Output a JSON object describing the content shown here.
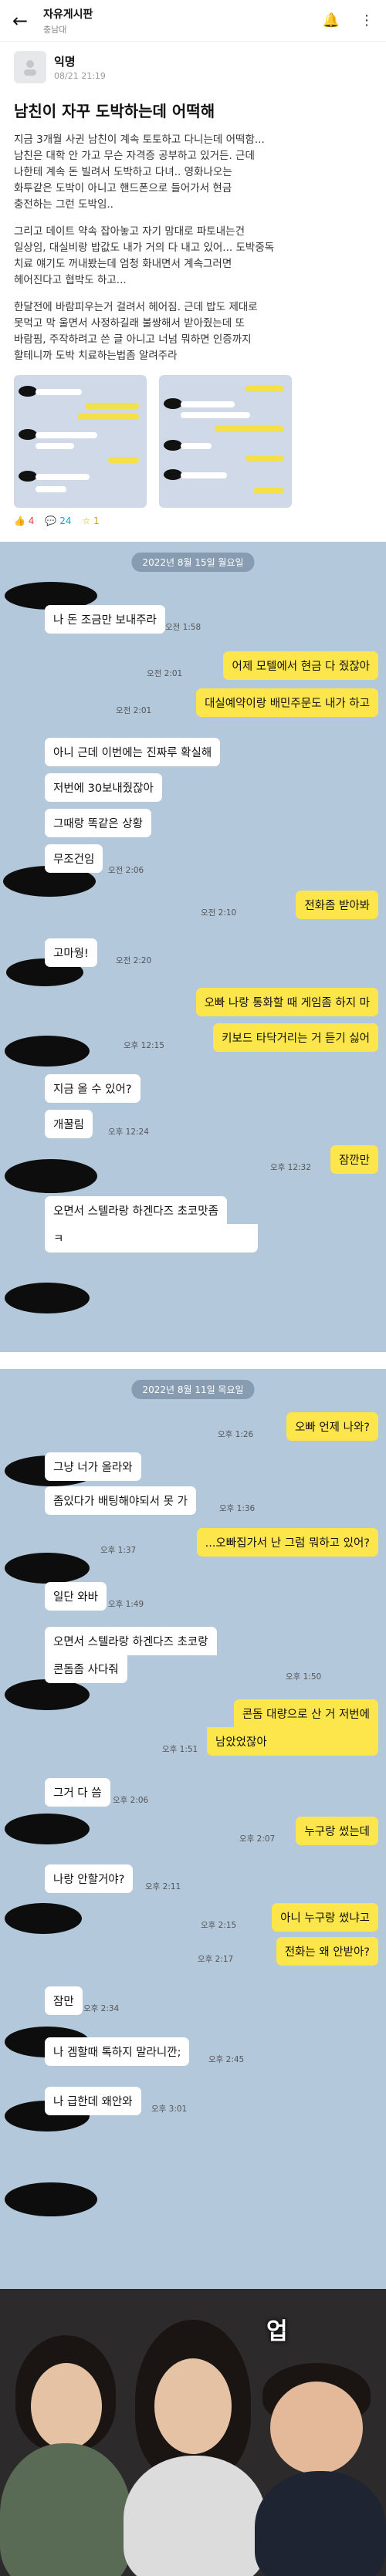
{
  "header": {
    "board": "자유게시판",
    "region": "충남대"
  },
  "post": {
    "author": "익명",
    "date": "08/21 21:19",
    "title": "남친이 자꾸 도박하는데 어떡해",
    "paragraphs": [
      "지금 3개월 사귄 남친이 계속 토토하고 다니는데 어떡함...\n남친은 대학 안 가고 무슨 자격증 공부하고 있거든. 근데\n나한테 계속 돈 빌려서 도박하고 다녀.. 영화나오는\n화투같은 도박이 아니고 핸드폰으로 들어가서 현금\n충전하는 그런 도박임..",
      "그리고 데이트 약속 잡아놓고 자기 맘대로 파토내는건\n일상임, 대실비랑 밥값도 내가 거의 다 내고 있어... 도박중독\n치료 얘기도 꺼내봤는데 엄청 화내면서 계속그러면\n헤어진다고 협박도 하고...",
      "한달전에 바람피우는거 걸려서 헤어짐. 근데 밥도 제대로\n못먹고 막 울면서 사정하길래 불쌍해서 받아줬는데 또\n바람핌, 주작하려고 쓴 글 아니고 너넘 뭐하면 인증까지\n할테니까 도박 치료하는법좀 알려주라"
    ],
    "likes": "4",
    "comments": "24",
    "scraps": "1"
  },
  "chat1": {
    "date": "2022년 8월 15일 월요일",
    "messages": [
      {
        "side": "l",
        "text": "나 돈 조금만 보내주라"
      },
      {
        "side": "t",
        "text": "오전 1:58"
      },
      {
        "side": "r",
        "text": "어제 모텔에서 현금 다 줬잖아"
      },
      {
        "side": "t",
        "text": "오전 2:01"
      },
      {
        "side": "r",
        "text": "대실예약이랑 배민주문도 내가 하고"
      },
      {
        "side": "t",
        "text": "오전 2:01"
      },
      {
        "side": "l",
        "text": "아니 근데 이번에는 진짜루 확실해"
      },
      {
        "side": "l",
        "text": "저번에 30보내줬잖아"
      },
      {
        "side": "l",
        "text": "그때랑 똑같은 상황"
      },
      {
        "side": "l",
        "text": "무조건임"
      },
      {
        "side": "t",
        "text": "오전 2:06"
      },
      {
        "side": "r",
        "text": "전화좀 받아봐"
      },
      {
        "side": "t",
        "text": "오전 2:10"
      },
      {
        "side": "l",
        "text": "고마웡!"
      },
      {
        "side": "t",
        "text": "오전 2:20"
      },
      {
        "side": "r",
        "text": "오빠 나랑 통화할 때 게임좀 하지 마"
      },
      {
        "side": "r",
        "text": "키보드 타닥거리는 거 듣기 싫어"
      },
      {
        "side": "t",
        "text": "오후 12:15"
      },
      {
        "side": "l",
        "text": "지금 올 수 있어?"
      },
      {
        "side": "l",
        "text": "개꿀림"
      },
      {
        "side": "t",
        "text": "오후 12:24"
      },
      {
        "side": "r",
        "text": "잠깐만"
      },
      {
        "side": "t",
        "text": "오후 12:32"
      },
      {
        "side": "l",
        "text": "오면서 스텔라랑 하겐다즈 초코맛좀"
      },
      {
        "side": "l",
        "text": "ㅋ"
      }
    ]
  },
  "chat2": {
    "date": "2022년 8월 11일 목요일",
    "messages": [
      {
        "side": "r",
        "text": "오빠 언제 나와?"
      },
      {
        "side": "t",
        "text": "오후 1:26"
      },
      {
        "side": "l",
        "text": "그냥 너가 올라와"
      },
      {
        "side": "l",
        "text": "좀있다가 배팅해야되서 못 가"
      },
      {
        "side": "t",
        "text": "오후 1:36"
      },
      {
        "side": "r",
        "text": "...오빠집가서 난 그럼 뭐하고 있어?"
      },
      {
        "side": "t",
        "text": "오후 1:37"
      },
      {
        "side": "l",
        "text": "일단 와바"
      },
      {
        "side": "t",
        "text": "오후 1:49"
      },
      {
        "side": "l",
        "text": "오면서 스텔라랑 하겐다즈 초코랑"
      },
      {
        "side": "l",
        "text": "콘돔좀 사다줘"
      },
      {
        "side": "t",
        "text": "오후 1:50"
      },
      {
        "side": "r",
        "text": "콘돔 대량으로 산 거 저번에"
      },
      {
        "side": "r",
        "text": "남았었잖아"
      },
      {
        "side": "t",
        "text": "오후 1:51"
      },
      {
        "side": "l",
        "text": "그거 다 씀"
      },
      {
        "side": "t",
        "text": "오후 2:06"
      },
      {
        "side": "r",
        "text": "누구랑 썼는데"
      },
      {
        "side": "t",
        "text": "오후 2:07"
      },
      {
        "side": "l",
        "text": "나랑 안할거야?"
      },
      {
        "side": "t",
        "text": "오후 2:11"
      },
      {
        "side": "r",
        "text": "아니 누구랑 썼냐고"
      },
      {
        "side": "t",
        "text": "오후 2:15"
      },
      {
        "side": "r",
        "text": "전화는 왜 안받아?"
      },
      {
        "side": "t",
        "text": "오후 2:17"
      },
      {
        "side": "l",
        "text": "잠만"
      },
      {
        "side": "t",
        "text": "오후 2:34"
      },
      {
        "side": "l",
        "text": "나 겜할때 톡하지 말라니깐;"
      },
      {
        "side": "t",
        "text": "오후 2:45"
      },
      {
        "side": "l",
        "text": "나 급한데 왜안와"
      },
      {
        "side": "t",
        "text": "오후 3:01"
      }
    ]
  },
  "meme": {
    "caption": "업"
  }
}
